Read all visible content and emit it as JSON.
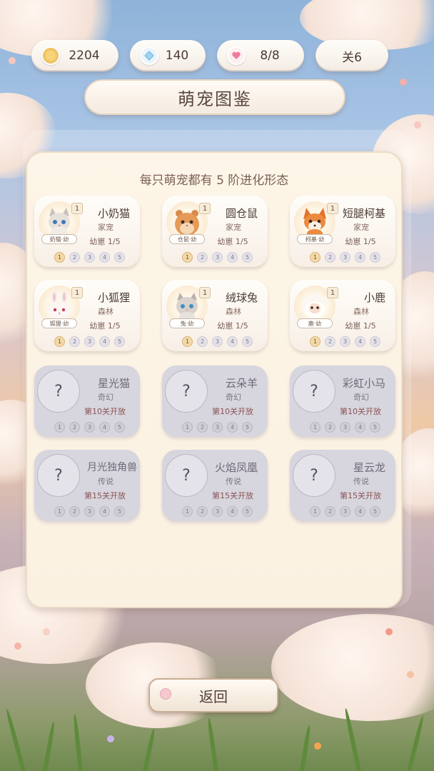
{
  "stats": {
    "coins": "2204",
    "gems": "140",
    "hearts": "8/8",
    "level": "关6"
  },
  "title": "萌宠图鉴",
  "subtitle": "每只萌宠都有 5 阶进化形态",
  "stage_labels": [
    "1",
    "2",
    "3",
    "4",
    "5"
  ],
  "pets": [
    {
      "name": "小奶猫",
      "type": "家宠",
      "stage": "幼崽 1/5",
      "tag": "奶猫·幼",
      "level": "1",
      "icon": "kitten-icon"
    },
    {
      "name": "圆仓鼠",
      "type": "家宠",
      "stage": "幼崽 1/5",
      "tag": "仓鼠·幼",
      "level": "1",
      "icon": "hamster-icon"
    },
    {
      "name": "短腿柯基",
      "type": "家宠",
      "stage": "幼崽 1/5",
      "tag": "柯基·幼",
      "level": "1",
      "icon": "corgi-icon"
    },
    {
      "name": "小狐狸",
      "type": "森林",
      "stage": "幼崽 1/5",
      "tag": "狐狸·幼",
      "level": "1",
      "icon": "bunny-icon"
    },
    {
      "name": "绒球兔",
      "type": "森林",
      "stage": "幼崽 1/5",
      "tag": "兔·幼",
      "level": "1",
      "icon": "cat-icon"
    },
    {
      "name": "小鹿",
      "type": "森林",
      "stage": "幼崽 1/5",
      "tag": "鹿·幼",
      "level": "1",
      "icon": "sheep-icon"
    }
  ],
  "locked_pets": [
    {
      "name": "星光猫",
      "type": "奇幻",
      "unlock": "第10关开放",
      "placeholder": "?"
    },
    {
      "name": "云朵羊",
      "type": "奇幻",
      "unlock": "第10关开放",
      "placeholder": "?"
    },
    {
      "name": "彩虹小马",
      "type": "奇幻",
      "unlock": "第10关开放",
      "placeholder": "?"
    },
    {
      "name": "月光独角兽",
      "type": "传说",
      "unlock": "第15关开放",
      "placeholder": "?"
    },
    {
      "name": "火焰凤凰",
      "type": "传说",
      "unlock": "第15关开放",
      "placeholder": "?"
    },
    {
      "name": "星云龙",
      "type": "传说",
      "unlock": "第15关开放",
      "placeholder": "?"
    }
  ],
  "back_label": "返回",
  "colors": {
    "panel": "#fbf1e1",
    "locked_card": "#d7d5dd",
    "active_dot": "#f3d9a8"
  }
}
